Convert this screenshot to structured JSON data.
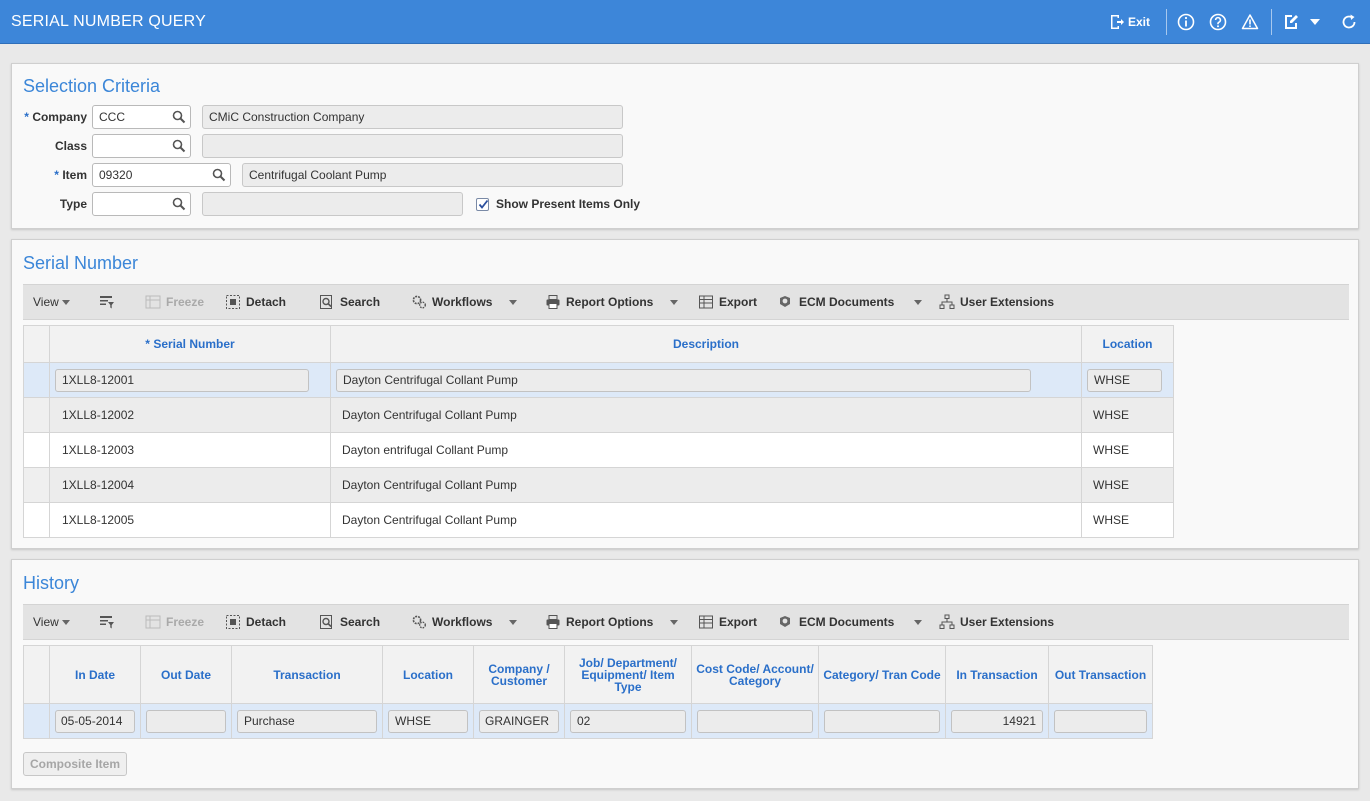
{
  "window": {
    "title": "SERIAL NUMBER QUERY",
    "exit_label": "Exit"
  },
  "selection": {
    "title": "Selection Criteria",
    "company": {
      "label": "Company",
      "required": "*",
      "value": "CCC",
      "description": "CMiC Construction Company"
    },
    "class": {
      "label": "Class",
      "value": "",
      "description": ""
    },
    "item": {
      "label": "Item",
      "required": "*",
      "value": "09320",
      "description": "Centrifugal Coolant Pump"
    },
    "type": {
      "label": "Type",
      "value": "",
      "description": ""
    },
    "show_present": {
      "label": "Show Present Items Only",
      "checked": true
    }
  },
  "toolbar": {
    "view": "View",
    "freeze": "Freeze",
    "detach": "Detach",
    "search": "Search",
    "workflows": "Workflows",
    "report_options": "Report Options",
    "export": "Export",
    "ecm_documents": "ECM Documents",
    "user_extensions": "User Extensions"
  },
  "serial": {
    "title": "Serial Number",
    "columns": {
      "serial_required": "*",
      "serial": "Serial Number",
      "description": "Description",
      "location": "Location"
    },
    "rows": [
      {
        "serial": "1XLL8-12001",
        "description": "Dayton Centrifugal Collant Pump",
        "location": "WHSE"
      },
      {
        "serial": "1XLL8-12002",
        "description": "Dayton Centrifugal Collant Pump",
        "location": "WHSE"
      },
      {
        "serial": "1XLL8-12003",
        "description": "Dayton entrifugal Collant Pump",
        "location": "WHSE"
      },
      {
        "serial": "1XLL8-12004",
        "description": "Dayton Centrifugal Collant Pump",
        "location": "WHSE"
      },
      {
        "serial": "1XLL8-12005",
        "description": "Dayton Centrifugal Collant Pump",
        "location": "WHSE"
      }
    ]
  },
  "history": {
    "title": "History",
    "columns": {
      "in_date": "In Date",
      "out_date": "Out Date",
      "transaction": "Transaction",
      "location": "Location",
      "company_customer": "Company / Customer",
      "job": "Job/ Department/ Equipment/ Item Type",
      "cost_code": "Cost Code/ Account/ Category",
      "category": "Category/ Tran Code",
      "in_transaction": "In Transaction",
      "out_transaction": "Out Transaction"
    },
    "row": {
      "in_date": "05-05-2014",
      "out_date": "",
      "transaction": "Purchase",
      "location": "WHSE",
      "company_customer": "GRAINGER",
      "job": "02",
      "cost_code": "",
      "category": "",
      "in_transaction": "14921",
      "out_transaction": ""
    },
    "composite_button": "Composite Item"
  }
}
